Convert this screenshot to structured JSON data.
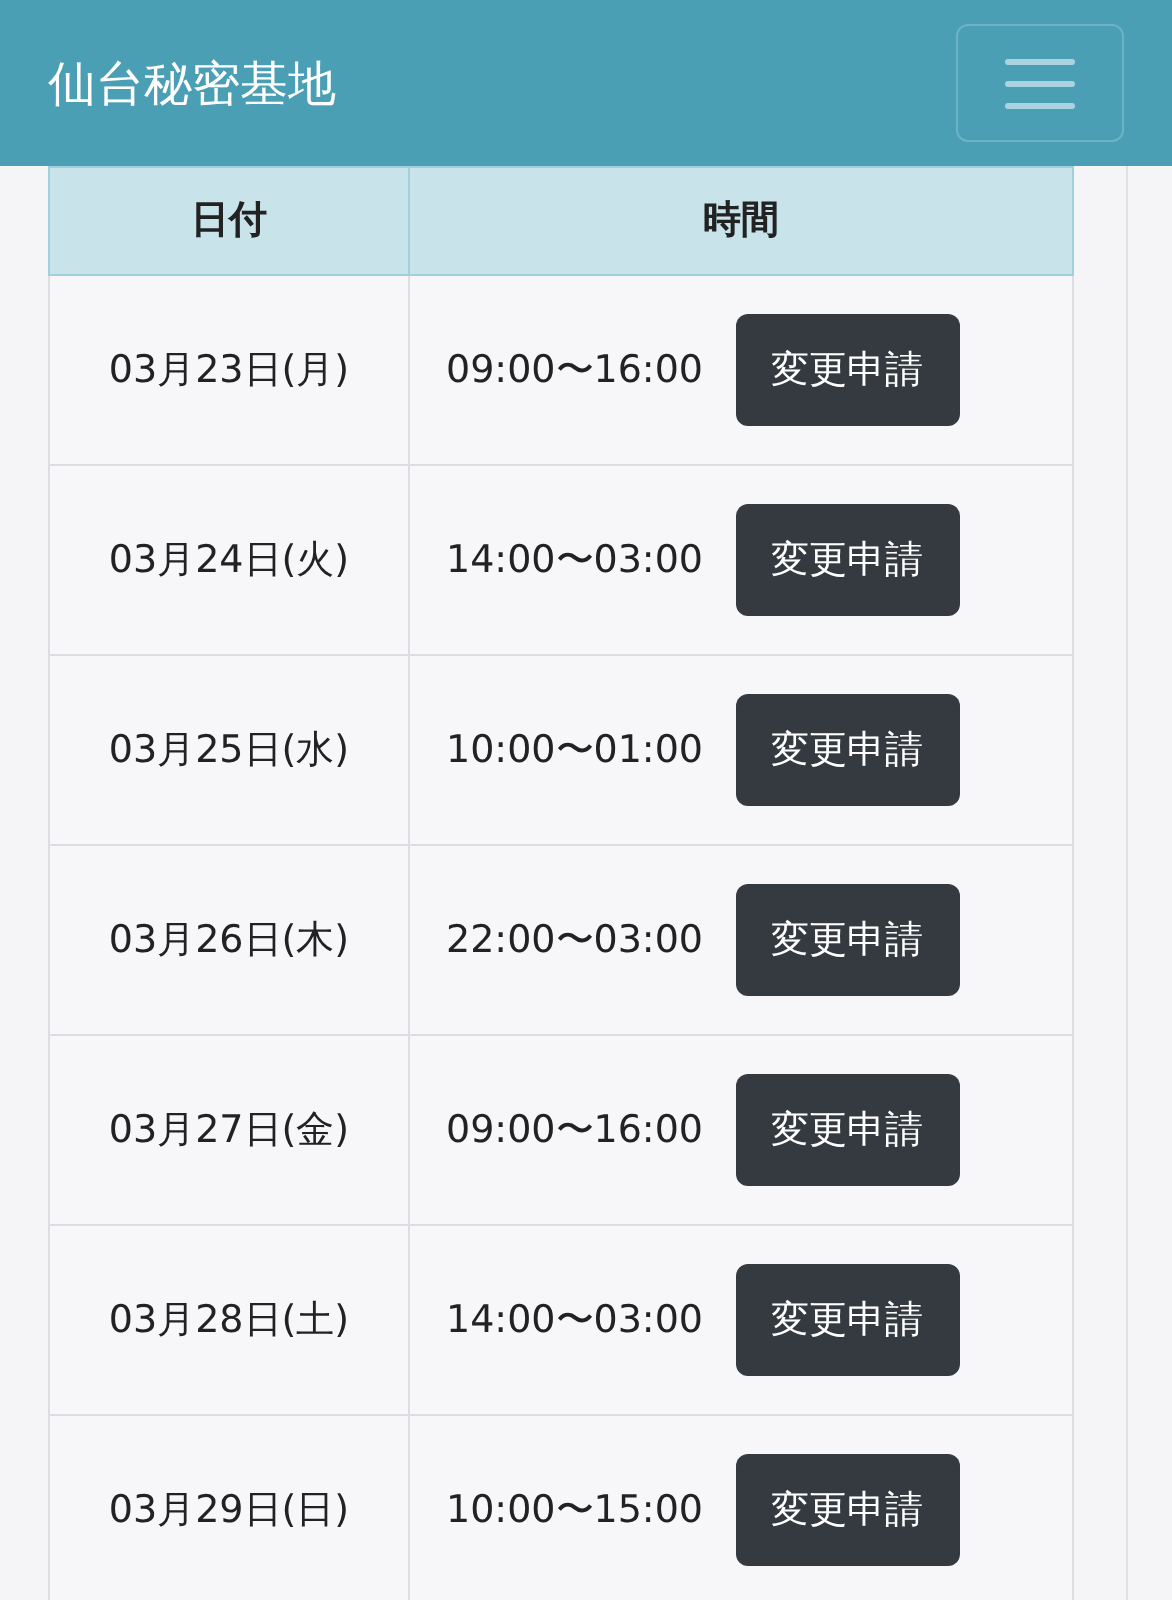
{
  "navbar": {
    "title": "仙台秘密基地"
  },
  "table": {
    "columns": [
      "日付",
      "時間"
    ],
    "rows": [
      {
        "date": "03月23日(月)",
        "time": "09:00〜16:00",
        "action": "変更申請"
      },
      {
        "date": "03月24日(火)",
        "time": "14:00〜03:00",
        "action": "変更申請"
      },
      {
        "date": "03月25日(水)",
        "time": "10:00〜01:00",
        "action": "変更申請"
      },
      {
        "date": "03月26日(木)",
        "time": "22:00〜03:00",
        "action": "変更申請"
      },
      {
        "date": "03月27日(金)",
        "time": "09:00〜16:00",
        "action": "変更申請"
      },
      {
        "date": "03月28日(土)",
        "time": "14:00〜03:00",
        "action": "変更申請"
      },
      {
        "date": "03月29日(日)",
        "time": "10:00〜15:00",
        "action": "変更申請"
      }
    ]
  }
}
